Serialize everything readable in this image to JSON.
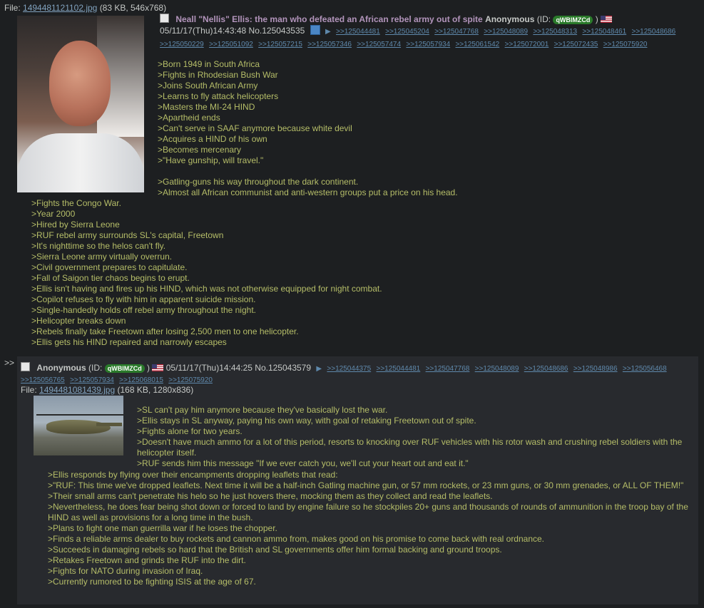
{
  "op": {
    "file_label": "File:",
    "file_name": "1494481121102.jpg",
    "file_meta": "(83 KB, 546x768)",
    "subject": "Neall \"Nellis\" Ellis: the man who defeated an African rebel army out of spite",
    "name": "Anonymous",
    "id_prefix": "(ID:",
    "id": "qWBlMZCd",
    "id_suffix": ")",
    "datetime": "05/11/17(Thu)14:43:48",
    "post_no": "No.125043535",
    "backlinks": [
      ">>125044481",
      ">>125045204",
      ">>125047768",
      ">>125048089",
      ">>125048313",
      ">>125048461",
      ">>125048686",
      ">>125050229",
      ">>125051092",
      ">>125057215",
      ">>125057346",
      ">>125057474",
      ">>125057934",
      ">>125061542",
      ">>125072001",
      ">>125072435",
      ">>125075920"
    ],
    "lines_right": [
      ">Born 1949 in South Africa",
      ">Fights in Rhodesian Bush War",
      ">Joins South African Army",
      ">Learns to fly attack helicopters",
      ">Masters the MI-24 HIND",
      ">Apartheid ends",
      ">Can't serve in SAAF anymore because white devil",
      ">Acquires a HIND of his own",
      ">Becomes mercenary",
      ">\"Have gunship, will travel.\"",
      "",
      ">Gatling-guns his way throughout the dark continent.",
      ">Almost all African communist and anti-western groups put a price on his head."
    ],
    "lines_full": [
      ">Fights the Congo War.",
      ">Year 2000",
      ">Hired by Sierra Leone",
      ">RUF rebel army surrounds SL's capital, Freetown",
      ">It's nighttime so the helos can't fly.",
      ">Sierra Leone army virtually overrun.",
      ">Civil government prepares to capitulate.",
      ">Fall of Saigon tier chaos begins to erupt.",
      ">Ellis isn't having and fires up his HIND, which was not otherwise equipped for night combat.",
      ">Copilot refuses to fly with him in apparent suicide mission.",
      ">Single-handedly holds off rebel army throughout the night.",
      ">Helicopter breaks down",
      ">Rebels finally take Freetown after losing 2,500 men to one helicopter.",
      ">Ellis gets his HIND repaired and narrowly escapes"
    ]
  },
  "reply": {
    "marker": ">>",
    "name": "Anonymous",
    "id_prefix": "(ID:",
    "id": "qWBlMZCd",
    "id_suffix": ")",
    "datetime": "05/11/17(Thu)14:44:25",
    "post_no": "No.125043579",
    "backlinks": [
      ">>125044375",
      ">>125044481",
      ">>125047768",
      ">>125048089",
      ">>125048686",
      ">>125048986",
      ">>125056468",
      ">>125056765",
      ">>125057934",
      ">>125068015",
      ">>125075920"
    ],
    "file_label": "File:",
    "file_name": "1494481081439.jpg",
    "file_meta": "(168 KB, 1280x836)",
    "lines_right": [
      ">SL can't pay him anymore because they've basically lost the war.",
      ">Ellis stays in SL anyway, paying his own way, with goal of retaking Freetown out of spite.",
      ">Fights alone for two years.",
      ">Doesn't have much ammo for a lot of this period, resorts to knocking over RUF vehicles with his rotor wash and crushing rebel soldiers with the helicopter itself.",
      ">RUF sends him this message \"If we ever catch you, we'll cut your heart out and eat it.\""
    ],
    "lines_full": [
      ">Ellis responds by flying over their encampments dropping leaflets that read:",
      ">\"RUF: This time we've dropped leaflets. Next time it will be a half-inch Gatling machine gun, or 57 mm rockets, or 23 mm guns, or 30 mm grenades, or ALL OF THEM!\"",
      ">Their small arms can't penetrate his helo so he just hovers there, mocking them as they collect and read the leaflets.",
      ">Nevertheless, he does fear being shot down or forced to land by engine failure so he stockpiles 20+ guns and thousands of rounds of ammunition in the troop bay of the HIND as well as provisions for a long time in the bush.",
      ">Plans to fight one man guerrilla war if he loses the chopper.",
      ">Finds a reliable arms dealer to buy rockets and cannon ammo from, makes good on his promise to come back with real ordnance.",
      ">Succeeds in damaging rebels so hard that the British and SL governments offer him formal backing and ground troops.",
      ">Retakes Freetown and grinds the RUF into the dirt.",
      ">Fights for NATO during invasion of Iraq.",
      ">Currently rumored to be fighting ISIS at the age of 67."
    ]
  }
}
